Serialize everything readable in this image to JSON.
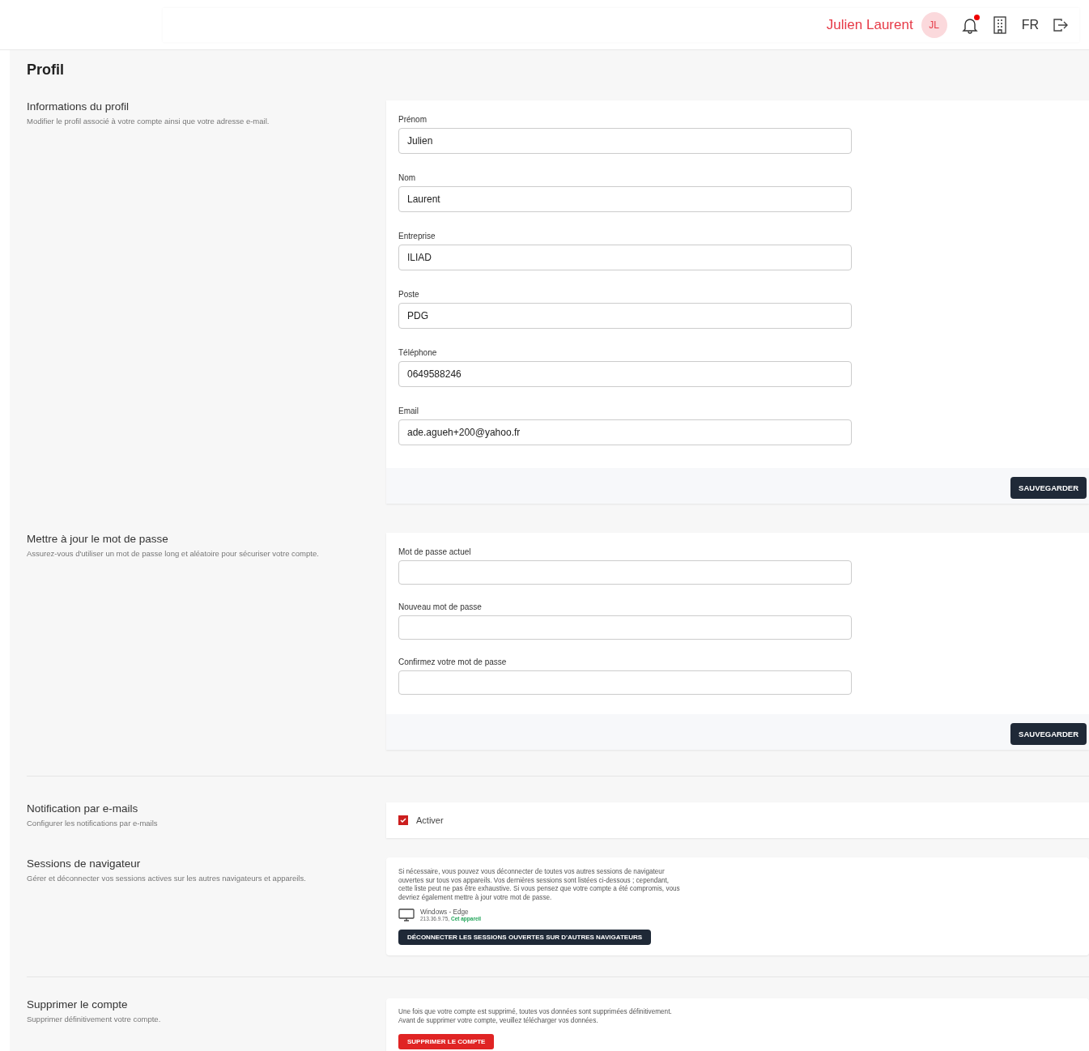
{
  "header": {
    "user_name": "Julien Laurent",
    "avatar_initials": "JL",
    "has_notification": true,
    "language": "FR"
  },
  "page_title": "Profil",
  "sections": [
    {
      "kind": "form",
      "title": "Informations du profil",
      "description": "Modifier le profil associé à votre compte ainsi que votre adresse e-mail.",
      "fields": [
        {
          "label": "Prénom",
          "value": "Julien"
        },
        {
          "label": "Nom",
          "value": "Laurent"
        },
        {
          "label": "Entreprise",
          "value": "ILIAD"
        },
        {
          "label": "Poste",
          "value": "PDG"
        },
        {
          "label": "Téléphone",
          "value": "0649588246"
        },
        {
          "label": "Email",
          "value": "ade.agueh+200@yahoo.fr"
        }
      ],
      "button": "SAUVEGARDER"
    },
    {
      "kind": "form",
      "title": "Mettre à jour le mot de passe",
      "description": "Assurez-vous d'utiliser un mot de passe long et aléatoire pour sécuriser votre compte.",
      "fields": [
        {
          "label": "Mot de passe actuel"
        },
        {
          "label": "Nouveau mot de passe"
        },
        {
          "label": "Confirmez votre mot de passe"
        }
      ],
      "button": "SAUVEGARDER",
      "divider_after": true
    },
    {
      "kind": "checkbox",
      "title": "Notification par e-mails",
      "description": "Configurer les notifications par e-mails",
      "checkbox": {
        "label": "Activer",
        "checked": true
      }
    },
    {
      "kind": "sessions",
      "title": "Sessions de navigateur",
      "description": "Gérer et déconnecter vos sessions actives sur les autres navigateurs et appareils.",
      "text": "Si nécessaire, vous pouvez vous déconnecter de toutes vos autres sessions de navigateur ouvertes sur tous vos appareils. Vos dernières sessions sont listées ci-dessous ; cependant, cette liste peut ne pas être exhaustive. Si vous pensez que votre compte a été compromis, vous devriez également mettre à jour votre mot de passe.",
      "session": {
        "device": "Windows - Edge",
        "ip": "213.36.9.75,",
        "current": "Cet appareil"
      },
      "button": "DÉCONNECTER LES SESSIONS OUVERTES SUR D'AUTRES NAVIGATEURS",
      "divider_after": true
    },
    {
      "kind": "delete",
      "title": "Supprimer le compte",
      "description": "Supprimer définitivement votre compte.",
      "text": "Une fois que votre compte est supprimé, toutes vos données sont supprimées définitivement. Avant de supprimer votre compte, veuillez télécharger vos données.",
      "button": "SUPPRIMER LE COMPTE"
    }
  ]
}
